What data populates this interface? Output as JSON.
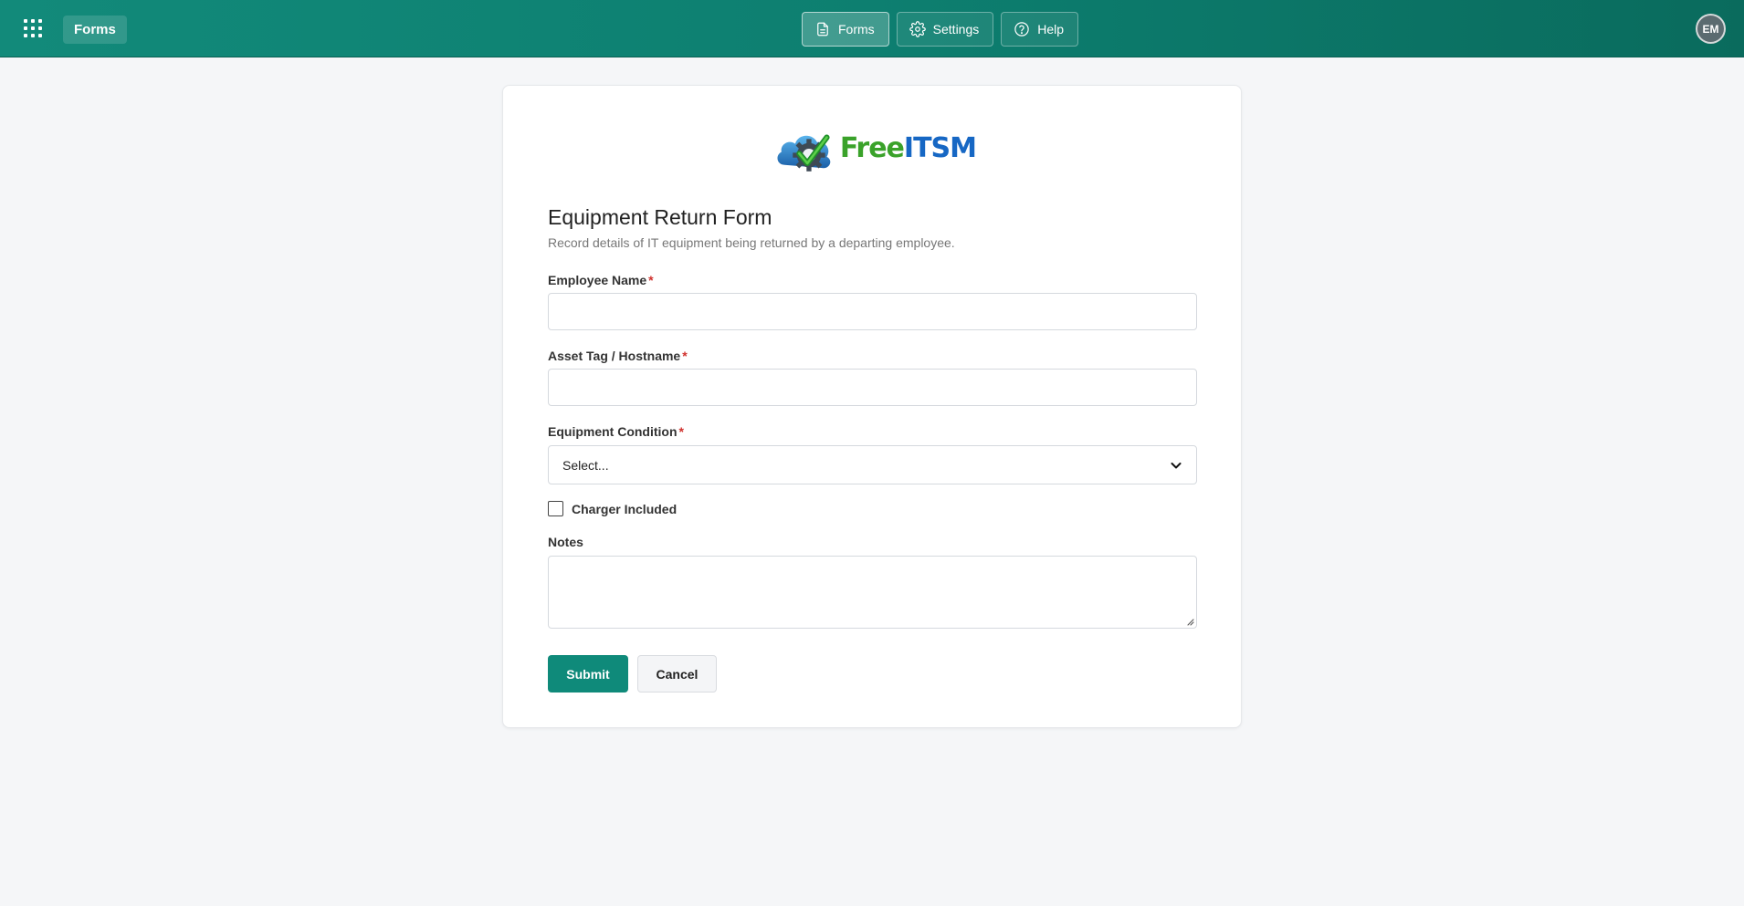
{
  "header": {
    "app_name": "Forms",
    "nav": [
      {
        "label": "Forms",
        "icon": "document-icon",
        "active": true
      },
      {
        "label": "Settings",
        "icon": "gear-icon",
        "active": false
      },
      {
        "label": "Help",
        "icon": "help-circle-icon",
        "active": false
      }
    ],
    "avatar_initials": "EM"
  },
  "logo": {
    "part1": "Free",
    "part2": "ITSM"
  },
  "form": {
    "title": "Equipment Return Form",
    "description": "Record details of IT equipment being returned by a departing employee.",
    "fields": {
      "employee_name": {
        "label": "Employee Name",
        "required": "*",
        "value": ""
      },
      "asset_tag": {
        "label": "Asset Tag / Hostname",
        "required": "*",
        "value": ""
      },
      "condition": {
        "label": "Equipment Condition",
        "required": "*",
        "selected": "Select..."
      },
      "charger": {
        "label": "Charger Included",
        "checked": false
      },
      "notes": {
        "label": "Notes",
        "value": ""
      }
    },
    "submit_label": "Submit",
    "cancel_label": "Cancel"
  },
  "colors": {
    "header_start": "#128a7a",
    "header_end": "#0a6b5d",
    "primary_button": "#0f8a7a",
    "required_marker": "#d0312d",
    "logo_green": "#3aa22a",
    "logo_blue": "#1667c4"
  }
}
